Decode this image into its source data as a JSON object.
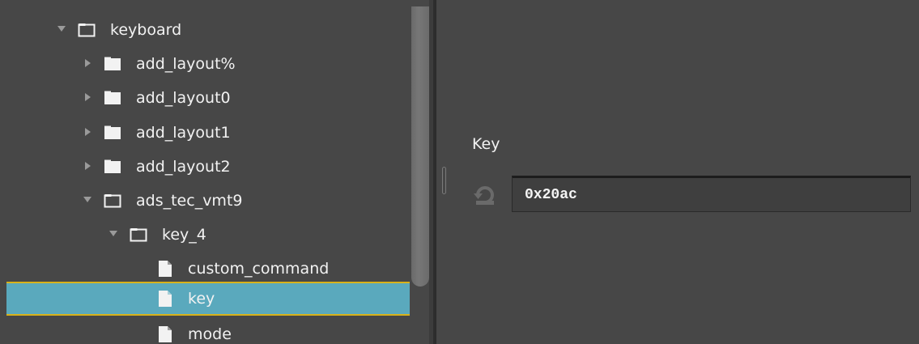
{
  "tree": {
    "items": [
      {
        "label": "keyboard",
        "type": "folder-open",
        "expanded": true
      },
      {
        "label": "add_layout%",
        "type": "folder-closed",
        "expanded": false
      },
      {
        "label": "add_layout0",
        "type": "folder-closed",
        "expanded": false
      },
      {
        "label": "add_layout1",
        "type": "folder-closed",
        "expanded": false
      },
      {
        "label": "add_layout2",
        "type": "folder-closed",
        "expanded": false
      },
      {
        "label": "ads_tec_vmt9",
        "type": "folder-open",
        "expanded": true
      },
      {
        "label": "key_4",
        "type": "folder-open",
        "expanded": true
      },
      {
        "label": "custom_command",
        "type": "file"
      },
      {
        "label": "key",
        "type": "file",
        "selected": true
      },
      {
        "label": "mode",
        "type": "file"
      }
    ]
  },
  "property": {
    "title": "Key",
    "value": "0x20ac",
    "revert_icon": "revert-icon"
  },
  "colors": {
    "background": "#474747",
    "selection": "#5aa9bd",
    "selection_border": "#d8b21b",
    "text": "#f2f2f2"
  }
}
